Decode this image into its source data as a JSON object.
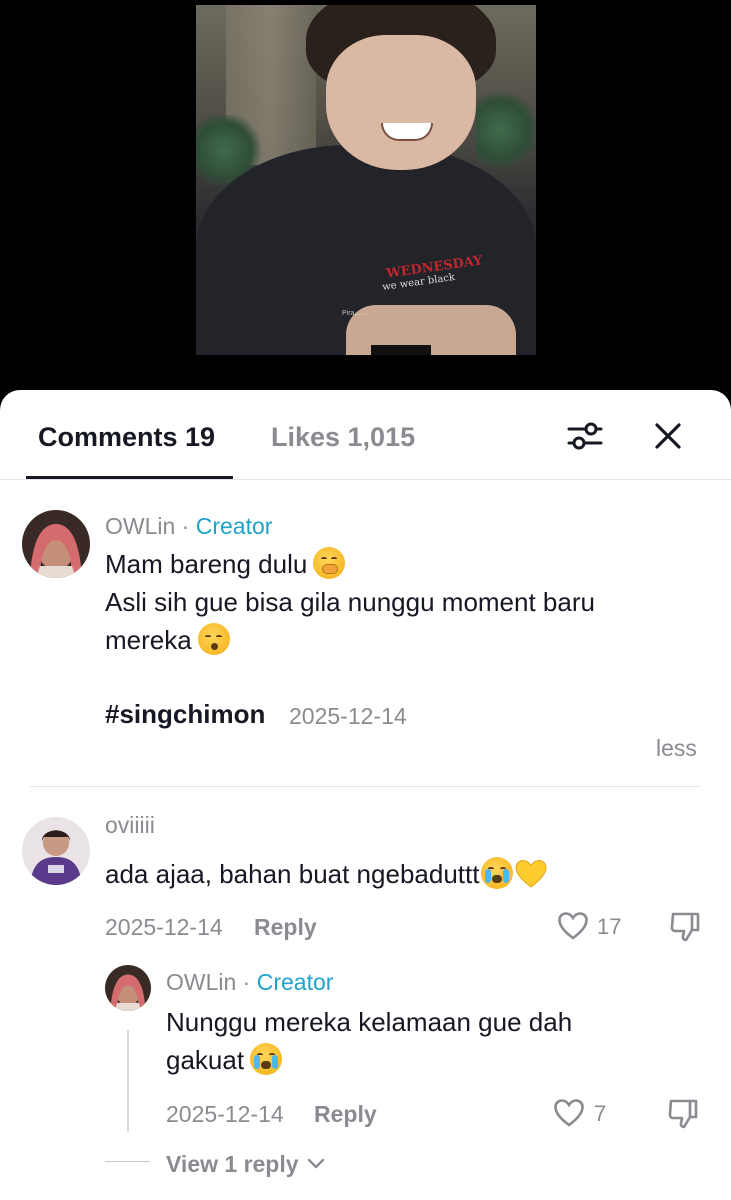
{
  "video": {
    "watermark": "Pira......"
  },
  "tabs": {
    "comments_label": "Comments 19",
    "likes_label": "Likes 1,015"
  },
  "comments": [
    {
      "username": "OWLin",
      "separator": " · ",
      "badge": "Creator",
      "lines": [
        "Mam bareng dulu",
        "Asli sih gue bisa gila nunggu moment baru",
        "mereka"
      ],
      "hashtag": "#singchimon",
      "date": "2025-12-14",
      "less_label": "less"
    },
    {
      "username": "oviiiii",
      "text": "ada ajaa, bahan buat ngebaduttt",
      "date": "2025-12-14",
      "reply_label": "Reply",
      "likes": "17",
      "replies": [
        {
          "username": "OWLin",
          "separator": " · ",
          "badge": "Creator",
          "lines": [
            "Nunggu mereka kelamaan gue dah",
            "gakuat"
          ],
          "date": "2025-12-14",
          "reply_label": "Reply",
          "likes": "7"
        }
      ],
      "view_replies_label": "View 1 reply"
    }
  ],
  "colors": {
    "text_primary": "#161823",
    "text_secondary": "#8a8b91",
    "creator_badge": "#1ea3c9",
    "sheet_bg": "#ffffff"
  },
  "icons": [
    "filter-icon",
    "close-icon",
    "heart-outline-icon",
    "dislike-icon",
    "chevron-down-icon"
  ]
}
